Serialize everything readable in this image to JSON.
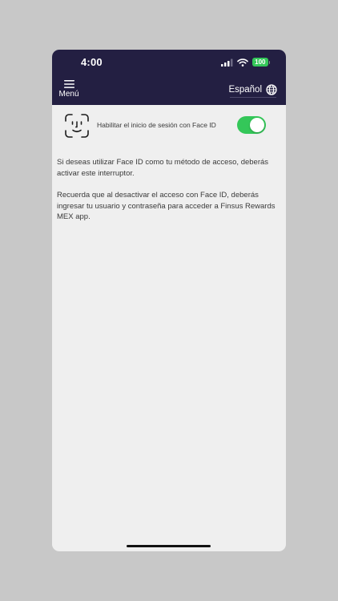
{
  "status_bar": {
    "time": "4:00",
    "battery": "100",
    "icons": [
      "cellular-signal-icon",
      "wifi-icon",
      "battery-icon"
    ]
  },
  "header": {
    "menu_label": "Menú",
    "language_label": "Español",
    "icons": [
      "hamburger-menu-icon",
      "globe-icon"
    ]
  },
  "face_id_setting": {
    "label": "Habilitar el inicio de sesión con Face ID",
    "enabled": true,
    "icon": "face-id-icon"
  },
  "info": {
    "paragraph_1": "Si deseas utilizar Face ID como tu método de acceso, deberás activar este interruptor.",
    "paragraph_2": "Recuerda que al desactivar el acceso con Face ID, deberás ingresar tu usuario y contraseña para acceder a Finsus Rewards MEX app."
  },
  "colors": {
    "header_bg": "#231f42",
    "toggle_on": "#34c759",
    "screen_bg": "#efefef",
    "backdrop": "#c8c8c8"
  }
}
